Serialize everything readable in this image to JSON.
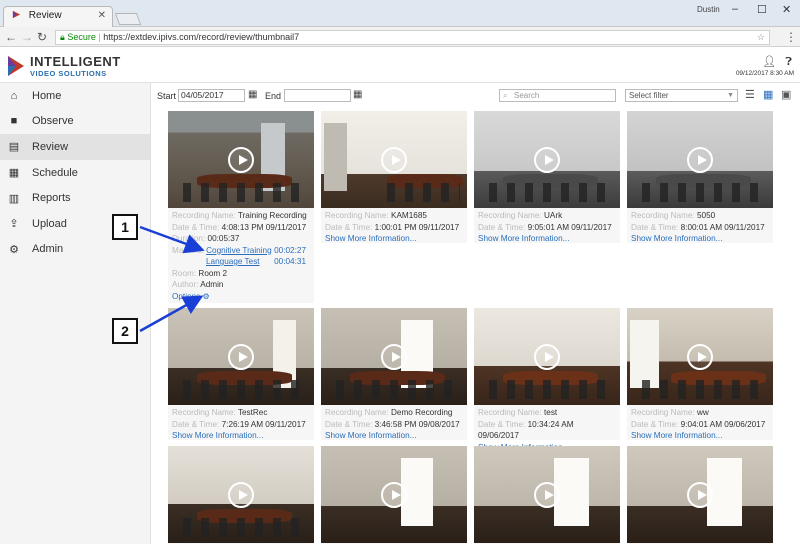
{
  "browser": {
    "tab_title": "Review",
    "user": "Dustin",
    "secure_label": "Secure",
    "url": "https://extdev.ipivs.com/record/review/thumbnail7"
  },
  "header": {
    "brand_line1": "INTELLIGENT",
    "brand_line2": "VIDEO SOLUTIONS",
    "date": "09/12/2017 8:30 AM"
  },
  "sidebar": {
    "items": [
      {
        "label": "Home",
        "icon": "home-icon"
      },
      {
        "label": "Observe",
        "icon": "video-camera-icon"
      },
      {
        "label": "Review",
        "icon": "film-icon"
      },
      {
        "label": "Schedule",
        "icon": "calendar-icon"
      },
      {
        "label": "Reports",
        "icon": "bar-chart-icon"
      },
      {
        "label": "Upload",
        "icon": "upload-icon"
      },
      {
        "label": "Admin",
        "icon": "gear-icon"
      }
    ]
  },
  "filters": {
    "start_label": "Start",
    "start_value": "04/05/2017",
    "end_label": "End",
    "end_value": "",
    "search_placeholder": "Search",
    "select_value": "Select filter"
  },
  "labels": {
    "recording_name": "Recording Name:",
    "date_time": "Date & Time:",
    "duration": "Duration:",
    "markers": "Markers:",
    "room": "Room:",
    "author": "Author:",
    "options": "Options",
    "show_more": "Show More Information..."
  },
  "recordings": [
    {
      "name": "Training Recording",
      "datetime": "4:08:13 PM 09/11/2017",
      "duration": "00:05:37",
      "markers": [
        {
          "label": "Cognitive Training",
          "time": "00:02:27"
        },
        {
          "label": "Language Test",
          "time": "00:04:31"
        }
      ],
      "room": "Room 2",
      "author": "Admin"
    },
    {
      "name": "KAM1685",
      "datetime": "1:00:01 PM 09/11/2017"
    },
    {
      "name": "UArk",
      "datetime": "9:05:01 AM 09/11/2017"
    },
    {
      "name": "5050",
      "datetime": "8:00:01 AM 09/11/2017"
    },
    {
      "name": "TestRec",
      "datetime": "7:26:19 AM 09/11/2017"
    },
    {
      "name": "Demo Recording",
      "datetime": "3:46:58 PM 09/08/2017"
    },
    {
      "name": "test",
      "datetime": "10:34:24 AM 09/06/2017"
    },
    {
      "name": "ww",
      "datetime": "9:04:01 AM 09/06/2017"
    }
  ],
  "callouts": [
    "1",
    "2"
  ],
  "colors": {
    "accent_link": "#2a6ebb",
    "secure_green": "#0a8a0a",
    "brand_blue": "#2c6fb0"
  }
}
